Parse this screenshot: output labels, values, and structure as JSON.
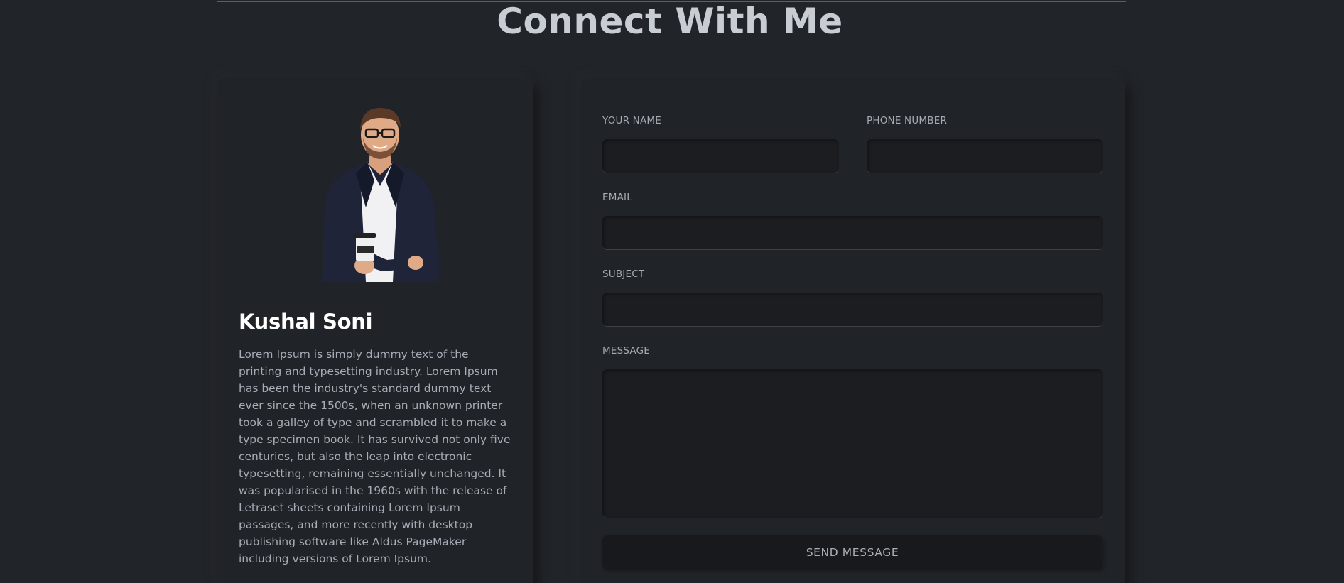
{
  "section": {
    "title": "Connect With Me"
  },
  "profile": {
    "name": "Kushal Soni",
    "bio": "Lorem Ipsum is simply dummy text of the printing and typesetting industry. Lorem Ipsum has been the industry's standard dummy text ever since the 1500s, when an unknown printer took a galley of type and scrambled it to make a type specimen book. It has survived not only five centuries, but also the leap into electronic typesetting, remaining essentially unchanged. It was popularised in the 1960s with the release of Letraset sheets containing Lorem Ipsum passages, and more recently with desktop publishing software like Aldus PageMaker including versions of Lorem Ipsum."
  },
  "form": {
    "name_label": "YOUR NAME",
    "name_value": "",
    "phone_label": "PHONE NUMBER",
    "phone_value": "",
    "email_label": "EMAIL",
    "email_value": "",
    "subject_label": "SUBJECT",
    "subject_value": "",
    "message_label": "MESSAGE",
    "message_value": "",
    "send_label": "SEND MESSAGE"
  },
  "colors": {
    "background": "#212429",
    "card": "#202328",
    "field": "#1b1d21",
    "title": "#c8ccd3"
  }
}
